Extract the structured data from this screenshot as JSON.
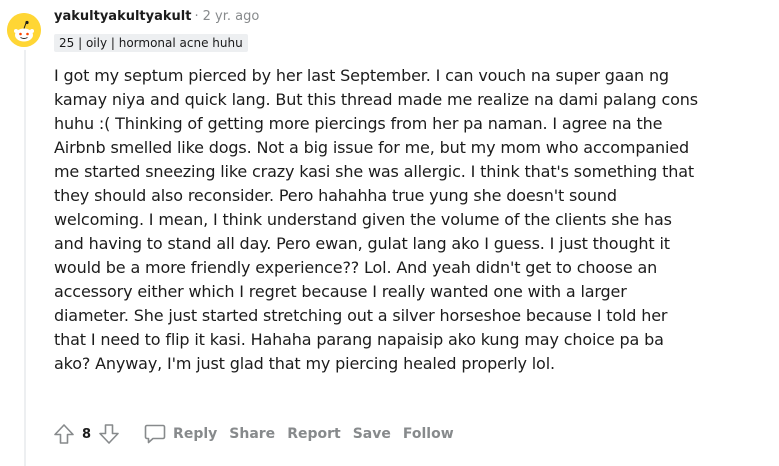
{
  "comment": {
    "username": "yakultyakultyakult",
    "separator": "·",
    "timestamp": "2 yr. ago",
    "flair": "25 | oily | hormonal acne huhu",
    "body": "I got my septum pierced by her last September. I can vouch na super gaan ng\nkamay niya and quick lang. But this thread made me realize na dami palang cons\nhuhu :( Thinking of getting more piercings from her pa naman. I agree na the\nAirbnb smelled like dogs. Not a big issue for me, but my mom who accompanied\nme started sneezing like crazy kasi she was allergic. I think that's something that\nthey should also reconsider. Pero hahahha true yung she doesn't sound\nwelcoming. I mean, I think understand given the volume of the clients she has\nand having to stand all day. Pero ewan, gulat lang ako I guess. I just thought it\nwould be a more friendly experience?? Lol. And yeah didn't get to choose an\naccessory either which I regret because I really wanted one with a larger\ndiameter. She just started stretching out a silver horseshoe because I told her\nthat I need to flip it kasi. Hahaha parang napaisip ako kung may choice pa ba\nako? Anyway, I'm just glad that my piercing healed properly lol.",
    "vote_count": "8"
  },
  "actions": {
    "reply": "Reply",
    "share": "Share",
    "report": "Report",
    "save": "Save",
    "follow": "Follow"
  },
  "icons": {
    "avatar": "snoo-avatar-icon",
    "upvote": "upvote-arrow-icon",
    "downvote": "downvote-arrow-icon",
    "reply": "speech-bubble-icon"
  },
  "colors": {
    "avatar_bg": "#ffd635",
    "muted_text": "#878a8c",
    "flair_bg": "#edeff1",
    "thread_line": "#edeff1"
  }
}
